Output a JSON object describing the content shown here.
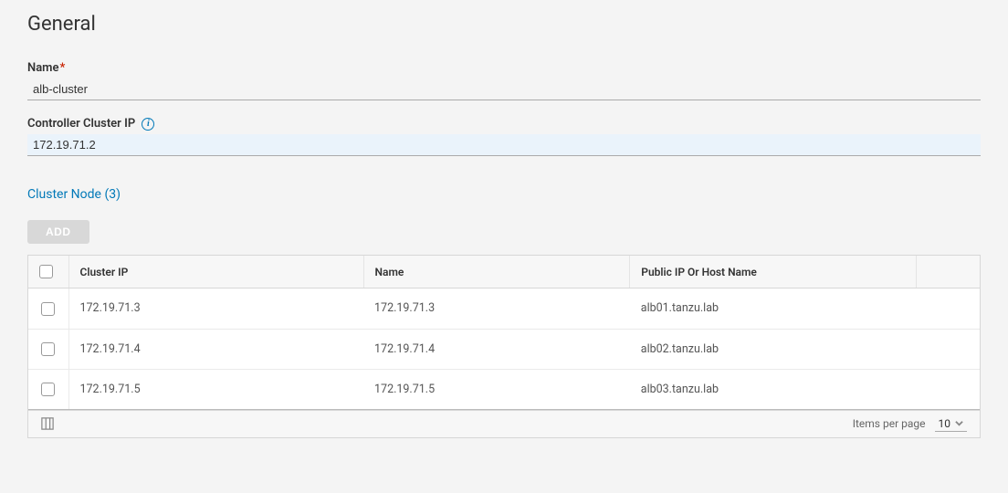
{
  "page": {
    "title": "General"
  },
  "form": {
    "name_label": "Name",
    "name_value": "alb-cluster",
    "controller_ip_label": "Controller Cluster IP",
    "controller_ip_value": "172.19.71.2"
  },
  "section_link": {
    "label": "Cluster Node (3)"
  },
  "actions": {
    "add_label": "ADD"
  },
  "table": {
    "headers": {
      "cluster_ip": "Cluster IP",
      "name": "Name",
      "public_ip": "Public IP Or Host Name"
    },
    "rows": [
      {
        "cluster_ip": "172.19.71.3",
        "name": "172.19.71.3",
        "public_ip": "alb01.tanzu.lab"
      },
      {
        "cluster_ip": "172.19.71.4",
        "name": "172.19.71.4",
        "public_ip": "alb02.tanzu.lab"
      },
      {
        "cluster_ip": "172.19.71.5",
        "name": "172.19.71.5",
        "public_ip": "alb03.tanzu.lab"
      }
    ]
  },
  "footer": {
    "items_per_page_label": "Items per page",
    "items_per_page_value": "10"
  }
}
